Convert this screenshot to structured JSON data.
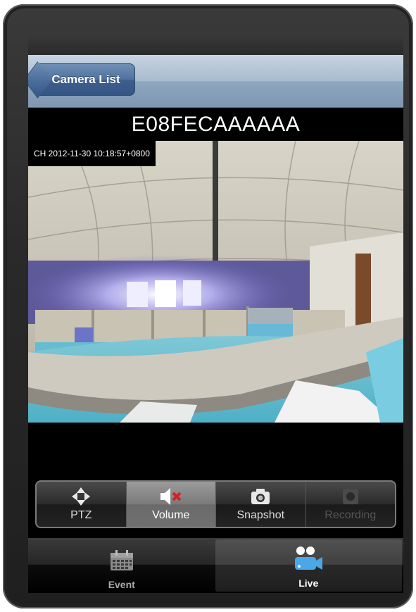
{
  "nav": {
    "back_label": "Camera List"
  },
  "camera": {
    "name": "E08FECAAAAAA",
    "timestamp": "CH 2012-11-30 10:18:57+0800"
  },
  "toolbar": {
    "items": [
      {
        "label": "PTZ",
        "icon": "ptz-arrows-icon",
        "state": "normal"
      },
      {
        "label": "Volume",
        "icon": "speaker-muted-icon",
        "state": "selected"
      },
      {
        "label": "Snapshot",
        "icon": "camera-icon",
        "state": "normal"
      },
      {
        "label": "Recording",
        "icon": "record-icon",
        "state": "disabled"
      }
    ]
  },
  "tabs": [
    {
      "label": "Event",
      "icon": "calendar-icon",
      "selected": false
    },
    {
      "label": "Live",
      "icon": "video-camera-users-icon",
      "selected": true
    }
  ],
  "colors": {
    "nav_bar": "#8fa6bf",
    "back_button": "#4f72a0",
    "accent_live": "#4aa8e8",
    "mute_red": "#d82020"
  }
}
